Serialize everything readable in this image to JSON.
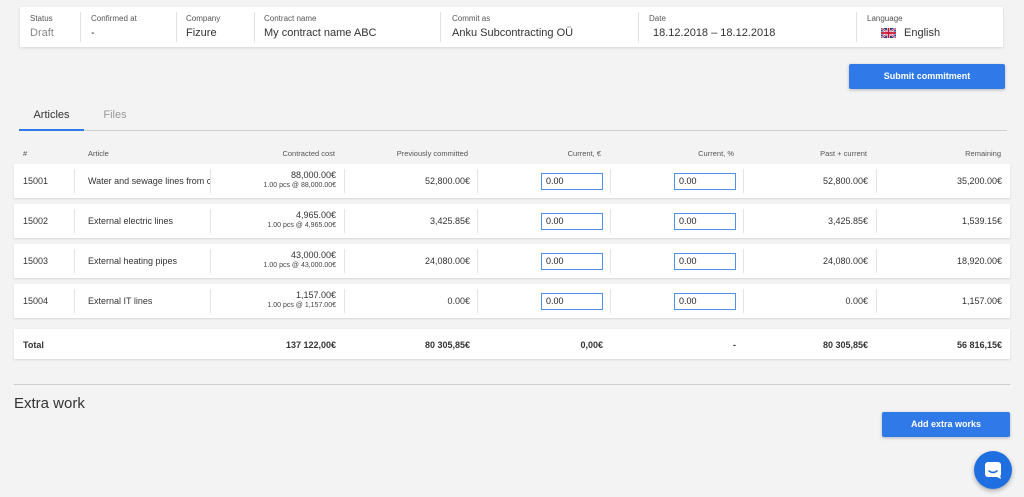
{
  "header": {
    "status": {
      "label": "Status",
      "value": "Draft"
    },
    "confirmed_at": {
      "label": "Confirmed at",
      "value": "-"
    },
    "company": {
      "label": "Company",
      "value": "Fizure"
    },
    "contract_name": {
      "label": "Contract name",
      "value": "My contract name ABC"
    },
    "commit_as": {
      "label": "Commit as",
      "value": "Anku Subcontracting OÜ"
    },
    "date": {
      "label": "Date",
      "value": "18.12.2018  –  18.12.2018"
    },
    "language": {
      "label": "Language",
      "value": "English",
      "flag_icon": "uk-flag-icon"
    }
  },
  "actions": {
    "submit_label": "Submit commitment",
    "add_extra_label": "Add extra works",
    "accent_color": "#2f79e9"
  },
  "tabs": [
    {
      "label": "Articles",
      "active": true
    },
    {
      "label": "Files",
      "active": false
    }
  ],
  "table": {
    "headers": [
      "#",
      "Article",
      "Contracted cost",
      "Previously committed",
      "Current, €",
      "Current, %",
      "Past + current",
      "Remaining"
    ],
    "rows": [
      {
        "id": "15001",
        "article": "Water and sewage lines from ce",
        "cost": "88,000.00€",
        "cost_detail": "1.00 pcs @ 88,000.00€",
        "prev": "52,800.00€",
        "cur_eur": "0.00",
        "cur_pct": "0.00",
        "past_cur": "52,800.00€",
        "remaining": "35,200.00€"
      },
      {
        "id": "15002",
        "article": "External electric lines",
        "cost": "4,965.00€",
        "cost_detail": "1.00 pcs @ 4,965.00€",
        "prev": "3,425.85€",
        "cur_eur": "0.00",
        "cur_pct": "0.00",
        "past_cur": "3,425.85€",
        "remaining": "1,539.15€"
      },
      {
        "id": "15003",
        "article": "External heating pipes",
        "cost": "43,000.00€",
        "cost_detail": "1.00 pcs @ 43,000.00€",
        "prev": "24,080.00€",
        "cur_eur": "0.00",
        "cur_pct": "0.00",
        "past_cur": "24,080.00€",
        "remaining": "18,920.00€"
      },
      {
        "id": "15004",
        "article": "External IT lines",
        "cost": "1,157.00€",
        "cost_detail": "1.00 pcs @ 1,157.00€",
        "prev": "0.00€",
        "cur_eur": "0.00",
        "cur_pct": "0.00",
        "past_cur": "0.00€",
        "remaining": "1,157.00€"
      }
    ],
    "total": {
      "label": "Total",
      "cost": "137 122,00€",
      "prev": "80 305,85€",
      "cur_eur": "0,00€",
      "cur_pct": "-",
      "past_cur": "80 305,85€",
      "remaining": "56 816,15€"
    }
  },
  "extra_work": {
    "title": "Extra work"
  },
  "chat": {
    "icon": "chat-bubble-icon"
  }
}
